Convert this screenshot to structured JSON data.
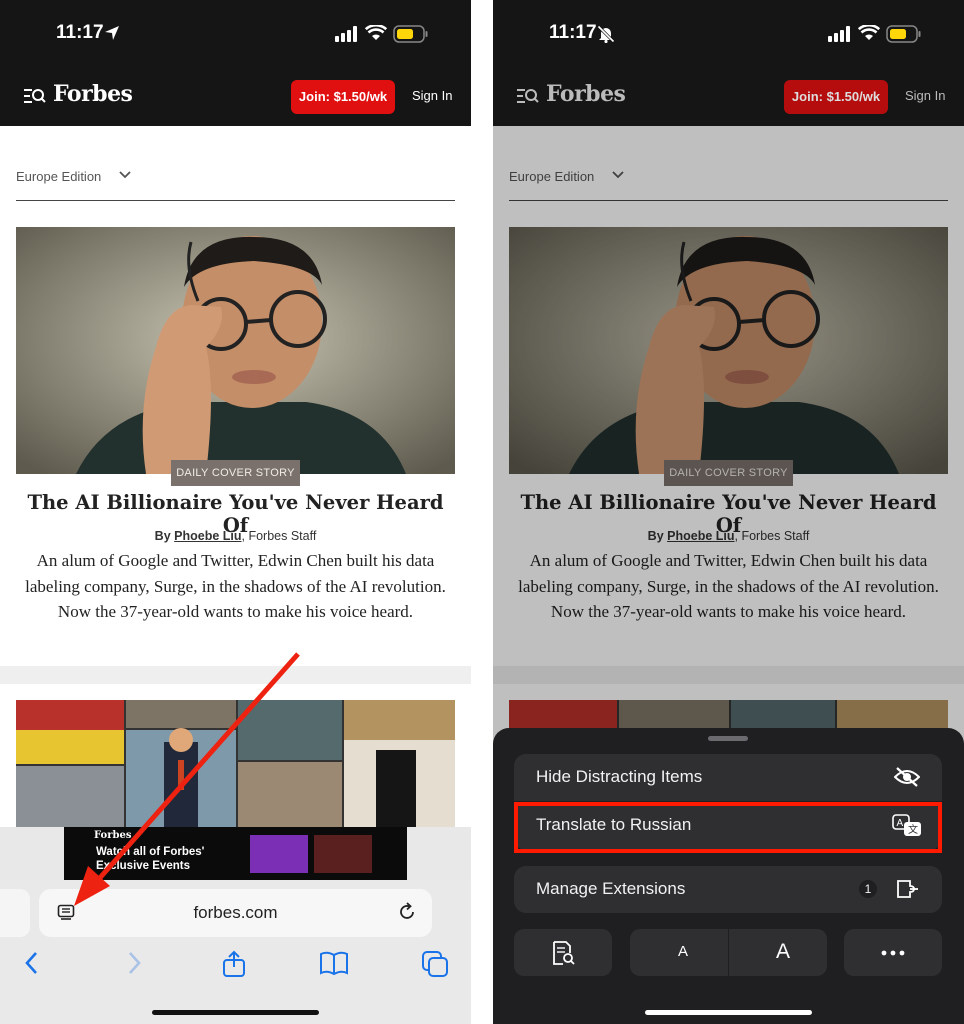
{
  "status": {
    "time": "11:17"
  },
  "forbes": {
    "logo": "Forbes",
    "join_label": "Join: $1.50/wk",
    "signin_label": "Sign In",
    "edition": "Europe Edition"
  },
  "article": {
    "badge": "DAILY COVER STORY",
    "headline": "The AI Billionaire You've Never Heard Of",
    "byline_prefix": "By",
    "author": "Phoebe Liu",
    "byline_suffix": ", Forbes Staff",
    "dek": "An alum of Google and Twitter, Edwin Chen built his data labeling company, Surge, in the shadows of the AI revolution. Now the 37-year-old wants to make his voice heard."
  },
  "ad": {
    "brand": "Forbes",
    "text": "Watch all of Forbes' Exclusive Events"
  },
  "safari": {
    "url": "forbes.com"
  },
  "sheet": {
    "hide_items": "Hide Distracting Items",
    "translate": "Translate to Russian",
    "manage_ext": "Manage Extensions",
    "ext_count": "1",
    "font_small": "A",
    "font_large": "A"
  },
  "colors": {
    "forbes_red": "#e01010",
    "header_bg": "#151515",
    "sheet_bg": "#1f1f21",
    "row_bg": "#2f2f32",
    "highlight": "#ff1a00",
    "safari_blue": "#1a73e8"
  }
}
